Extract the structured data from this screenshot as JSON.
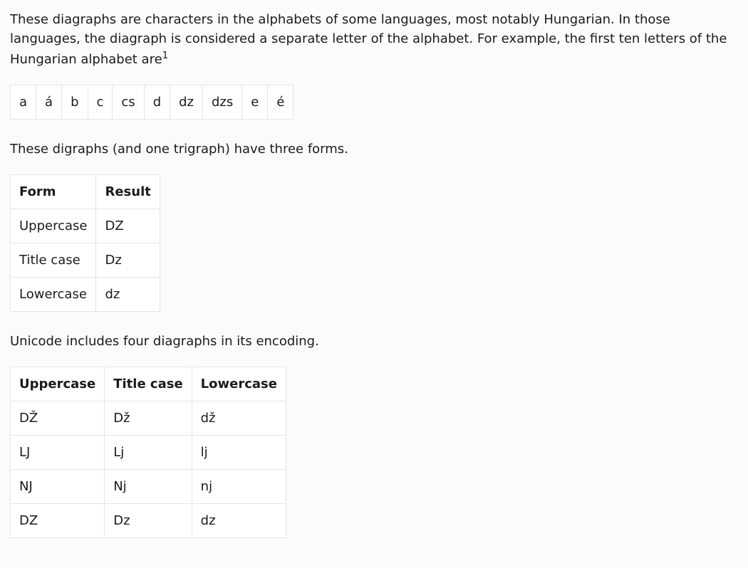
{
  "paragraphs": {
    "p1": "These diagraphs are characters in the alphabets of some languages, most notably Hungarian. In those languages, the diagraph is considered a separate letter of the alphabet. For example, the first ten letters of the Hungarian alphabet are",
    "p1_footnote": "1",
    "p2": "These digraphs (and one trigraph) have three forms.",
    "p3": "Unicode includes four diagraphs in its encoding."
  },
  "alphabet": [
    "a",
    "á",
    "b",
    "c",
    "cs",
    "d",
    "dz",
    "dzs",
    "e",
    "é"
  ],
  "forms_table": {
    "headers": {
      "col1": "Form",
      "col2": "Result"
    },
    "rows": [
      {
        "form": "Uppercase",
        "result": "DZ"
      },
      {
        "form": "Title case",
        "result": "Dz"
      },
      {
        "form": "Lowercase",
        "result": "dz"
      }
    ]
  },
  "digraphs_table": {
    "headers": {
      "col1": "Uppercase",
      "col2": "Title case",
      "col3": "Lowercase"
    },
    "rows": [
      {
        "upper": "DŽ",
        "title": "Dž",
        "lower": "dž"
      },
      {
        "upper": "LJ",
        "title": "Lj",
        "lower": "lj"
      },
      {
        "upper": "NJ",
        "title": "Nj",
        "lower": "nj"
      },
      {
        "upper": "DZ",
        "title": "Dz",
        "lower": "dz"
      }
    ]
  }
}
